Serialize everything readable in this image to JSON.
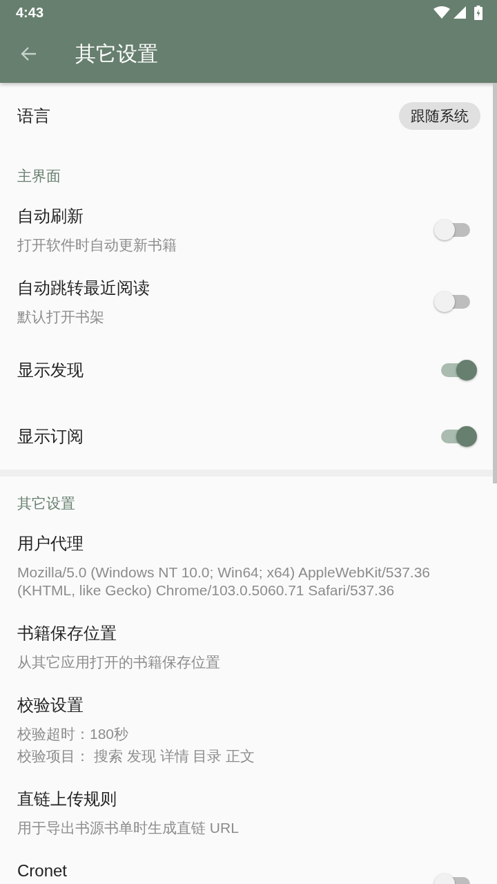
{
  "status_bar": {
    "time": "4:43"
  },
  "app_bar": {
    "title": "其它设置"
  },
  "language": {
    "title": "语言",
    "value": "跟随系统"
  },
  "categories": [
    {
      "header": "主界面",
      "items": [
        {
          "kind": "switch",
          "title": "自动刷新",
          "summary": "打开软件时自动更新书籍",
          "on": false
        },
        {
          "kind": "switch",
          "title": "自动跳转最近阅读",
          "summary": "默认打开书架",
          "on": false
        },
        {
          "kind": "switch",
          "title": "显示发现",
          "on": true
        },
        {
          "kind": "switch",
          "title": "显示订阅",
          "on": true
        }
      ]
    },
    {
      "header": "其它设置",
      "items": [
        {
          "kind": "text",
          "title": "用户代理",
          "summary": "Mozilla/5.0 (Windows NT 10.0; Win64; x64) AppleWebKit/537.36 (KHTML, like Gecko) Chrome/103.0.5060.71 Safari/537.36"
        },
        {
          "kind": "text",
          "title": "书籍保存位置",
          "summary": "从其它应用打开的书籍保存位置"
        },
        {
          "kind": "text",
          "title": "校验设置",
          "summary": [
            "校验超时：180秒",
            "校验项目： 搜索 发现 详情 目录 正文"
          ]
        },
        {
          "kind": "text",
          "title": "直链上传规则",
          "summary": "用于导出书源书单时生成直链 URL"
        },
        {
          "kind": "switch",
          "title": "Cronet",
          "on": false,
          "cut_off": true
        }
      ]
    }
  ]
}
